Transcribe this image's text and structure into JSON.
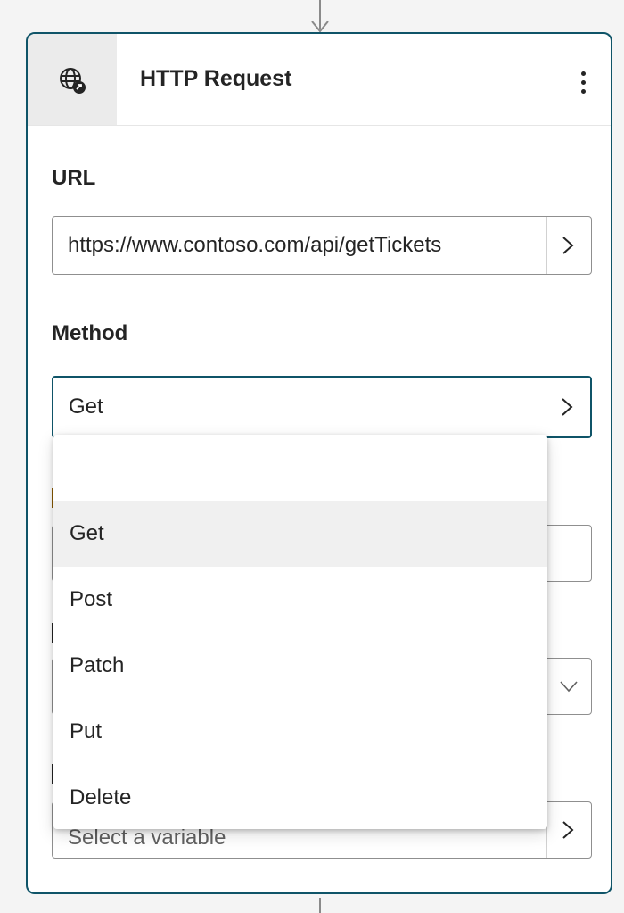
{
  "card": {
    "title": "HTTP Request",
    "icon": "globe-icon",
    "menu_icon": "more-vertical-icon"
  },
  "url_field": {
    "label": "URL",
    "value": "https://www.contoso.com/api/getTickets"
  },
  "method_field": {
    "label": "Method",
    "value": "Get"
  },
  "method_dropdown": {
    "options": [
      "Get",
      "Post",
      "Patch",
      "Put",
      "Delete"
    ],
    "selected": "Get"
  },
  "save_field": {
    "placeholder": "Select a variable"
  },
  "colors": {
    "accent": "#0f5468",
    "selected_option_bg": "#f0f0f0",
    "header_icon_bg": "#ebebeb"
  }
}
